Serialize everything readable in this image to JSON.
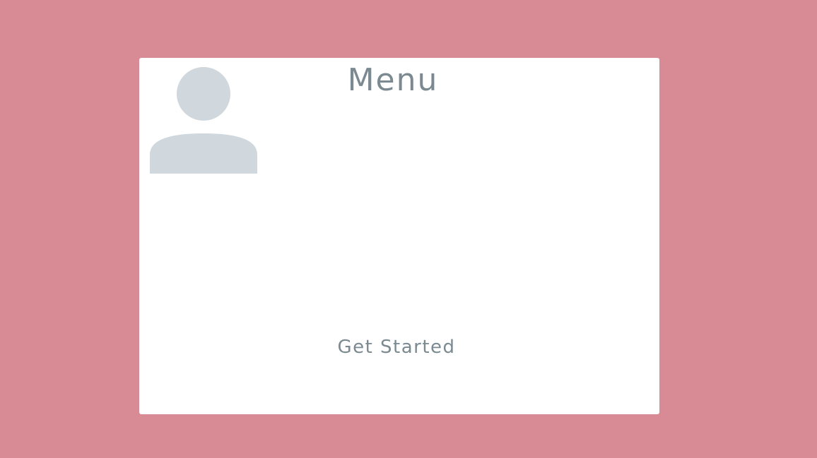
{
  "page": {
    "background_color": "#d88a95"
  },
  "card": {
    "background_color": "#ffffff",
    "title": "Menu",
    "cta_label": "Get Started",
    "text_color": "#7b8a91"
  },
  "avatar": {
    "icon": "user-icon",
    "color": "#d0d8dd"
  }
}
